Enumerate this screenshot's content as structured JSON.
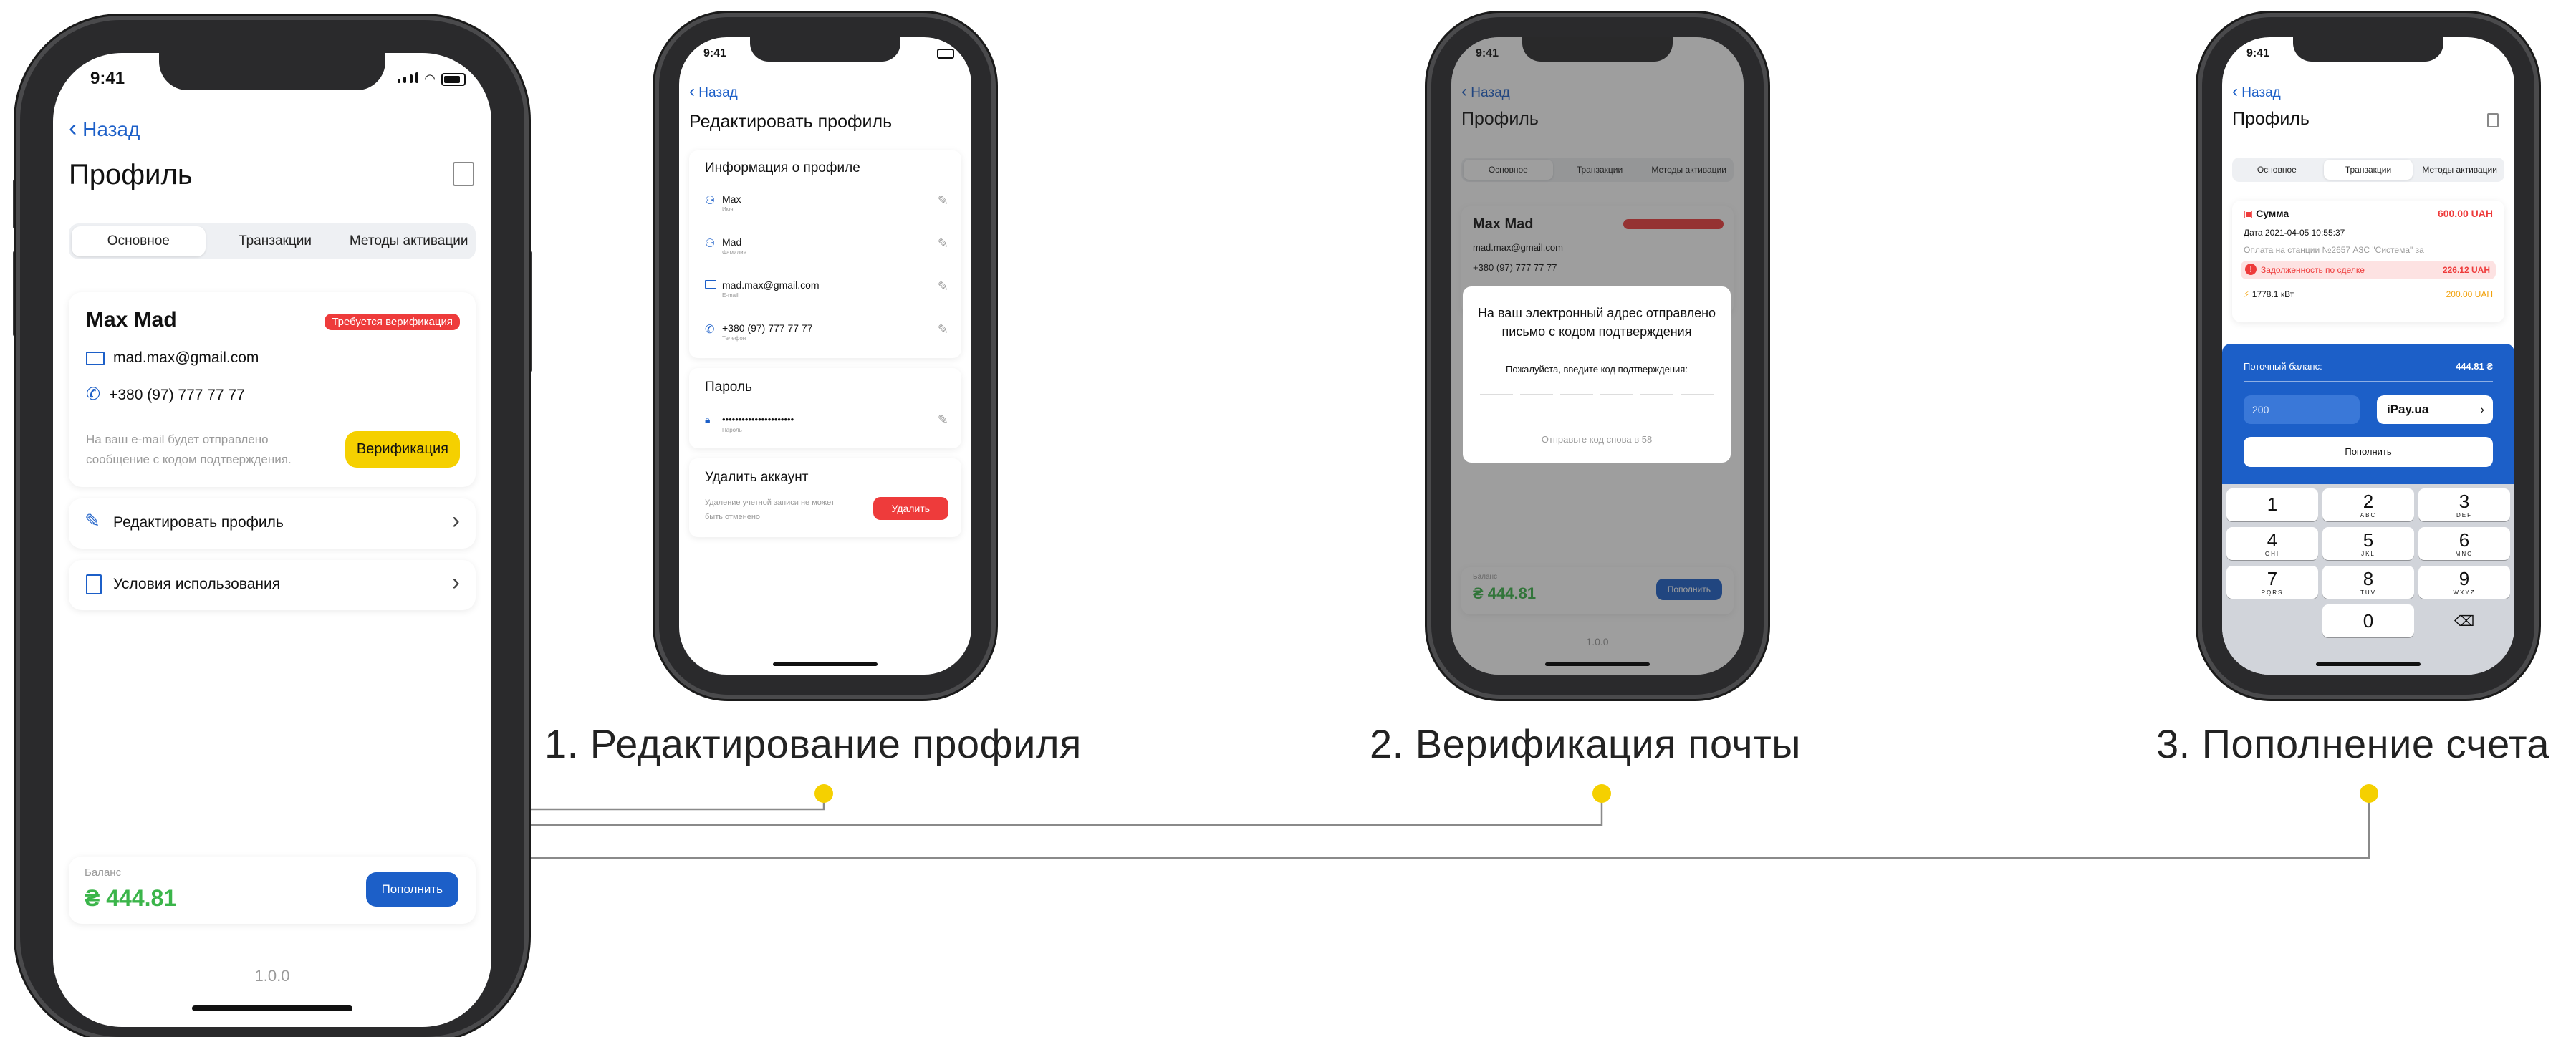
{
  "status_time": "9:41",
  "profile": {
    "back": "Назад",
    "title": "Профиль",
    "tabs": [
      "Основное",
      "Транзакции",
      "Методы активации"
    ],
    "user_name": "Max Mad",
    "badge": "Требуется верификация",
    "email": "mad.max@gmail.com",
    "phone": "+380 (97) 777 77 77",
    "note": "На ваш e-mail будет отправлено сообщение с кодом подтверждения.",
    "verify_button": "Верификация",
    "edit_profile": "Редактировать профиль",
    "terms": "Условия использования",
    "balance_label": "Баланс",
    "balance_value": "₴ 444.81",
    "topup_button": "Пополнить",
    "version": "1.0.0"
  },
  "edit": {
    "back": "Назад",
    "title": "Редактировать профиль",
    "info_header": "Информация о профиле",
    "fields": [
      {
        "value": "Max",
        "label": "Имя"
      },
      {
        "value": "Mad",
        "label": "Фамилия"
      },
      {
        "value": "mad.max@gmail.com",
        "label": "E-mail"
      },
      {
        "value": "+380 (97) 777 77 77",
        "label": "Телефон"
      }
    ],
    "password_header": "Пароль",
    "password_value": "••••••••••••••••••••••",
    "password_label": "Пароль",
    "delete_header": "Удалить аккаунт",
    "delete_note": "Удаление учетной записи не может быть отменено",
    "delete_button": "Удалить"
  },
  "verify": {
    "back": "Назад",
    "title": "Профиль",
    "tabs": [
      "Основное",
      "Транзакции",
      "Методы активации"
    ],
    "user_name": "Max Mad",
    "email": "mad.max@gmail.com",
    "phone": "+380 (97) 777 77 77",
    "modal_title": "На ваш электронный адрес отправлено письмо с кодом подтверждения",
    "modal_prompt": "Пожалуйста, введите код подтверждения:",
    "resend": "Отправьте код снова в 58",
    "balance_label": "Баланс",
    "balance_value": "₴ 444.81",
    "topup_button": "Пополнить",
    "version": "1.0.0"
  },
  "topup": {
    "back": "Назад",
    "title": "Профиль",
    "tabs": [
      "Основное",
      "Транзакции",
      "Методы активации"
    ],
    "sum_label": "Сумма",
    "sum_value": "600.00 UAH",
    "date": "Дата 2021-04-05 10:55:37",
    "station": "Оплата на станции №2657 АЗС \"Система\" за",
    "debt_label": "Задолженность по сделке",
    "debt_value": "226.12 UAH",
    "energy_label": "1778.1 кВт",
    "energy_value": "200.00 UAH",
    "current_balance_label": "Поточный баланс:",
    "current_balance_value": "444.81 ₴",
    "amount_input": "200",
    "provider": "iPay.ua",
    "topup_button": "Пополнить",
    "keys": [
      {
        "n": "1",
        "l": ""
      },
      {
        "n": "2",
        "l": "ABC"
      },
      {
        "n": "3",
        "l": "DEF"
      },
      {
        "n": "4",
        "l": "GHI"
      },
      {
        "n": "5",
        "l": "JKL"
      },
      {
        "n": "6",
        "l": "MNO"
      },
      {
        "n": "7",
        "l": "PQRS"
      },
      {
        "n": "8",
        "l": "TUV"
      },
      {
        "n": "9",
        "l": "WXYZ"
      },
      {
        "n": "0",
        "l": ""
      }
    ]
  },
  "captions": {
    "c1": "1. Редактирование профиля",
    "c2": "2. Верификация почты",
    "c3": "3. Пополнение счета"
  },
  "colors": {
    "accent_blue": "#1c5fc8",
    "badge_red": "#ee3b3b",
    "verify_yellow": "#f5d000",
    "balance_green": "#3bb54a",
    "debt_orange": "#f2a20c",
    "connector": "#8a8a8a"
  }
}
